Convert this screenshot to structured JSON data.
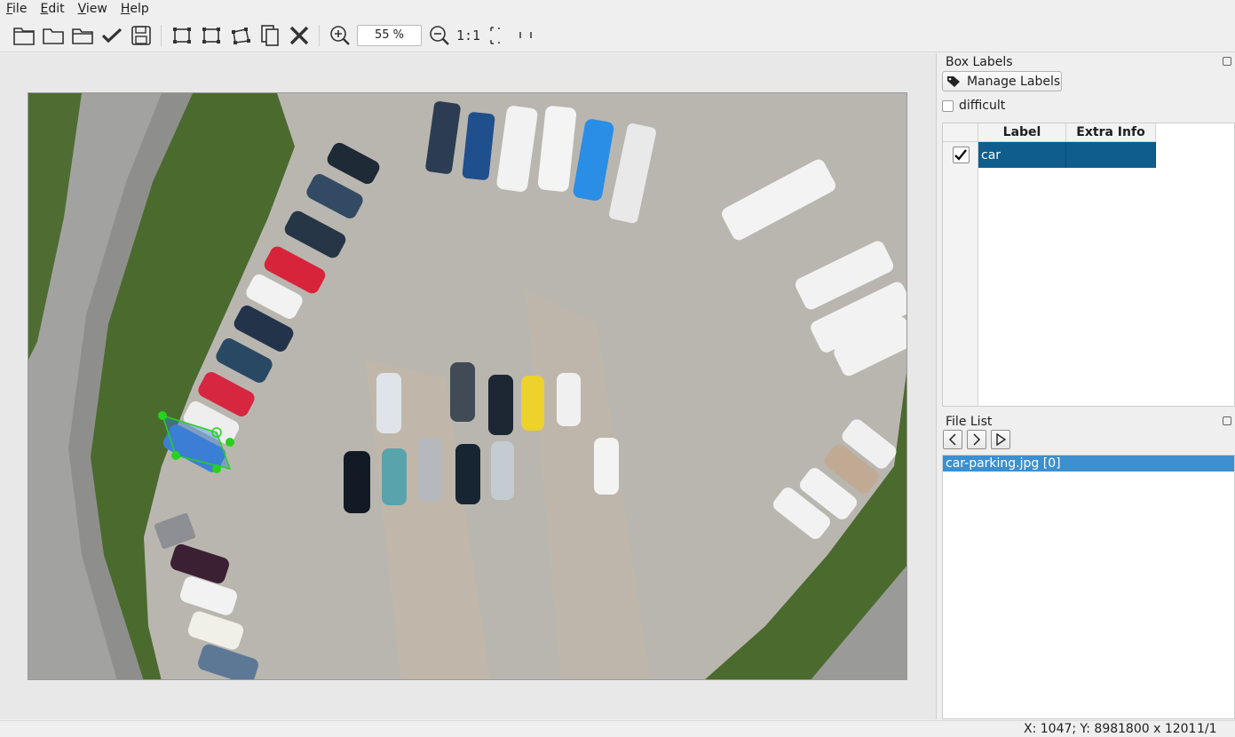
{
  "menu": [
    {
      "mnemonic": "F",
      "rest": "ile"
    },
    {
      "mnemonic": "E",
      "rest": "dit"
    },
    {
      "mnemonic": "V",
      "rest": "iew"
    },
    {
      "mnemonic": "H",
      "rest": "elp"
    }
  ],
  "toolbar": {
    "zoom_value": "55 %",
    "one_to_one": "1:1",
    "icons": [
      "open-file-icon",
      "open-folder-icon",
      "change-save-dir-icon",
      "verify-icon",
      "save-icon",
      "create-rect-icon",
      "edit-rect-icon",
      "create-polygon-icon",
      "duplicate-icon",
      "delete-icon",
      "zoom-in-icon",
      "zoom-out-icon",
      "fit-window-icon",
      "fit-width-icon"
    ]
  },
  "box_labels": {
    "title": "Box Labels",
    "manage_labels": "Manage Labels",
    "difficult": "difficult",
    "columns": [
      "Label",
      "Extra Info"
    ],
    "rows": [
      {
        "checked": true,
        "label": "car",
        "extra": ""
      }
    ]
  },
  "file_list": {
    "title": "File List",
    "items": [
      "car-parking.jpg [0]"
    ]
  },
  "status": {
    "coords": "X: 1047; Y: 898",
    "size": "1800 x 1201",
    "index": "1/1"
  },
  "colors": {
    "selection": "#0e5d8c",
    "file_selected": "#3d8fcd",
    "annotation_box": "#3a7fd8",
    "annotation_handle": "#27d21e"
  }
}
